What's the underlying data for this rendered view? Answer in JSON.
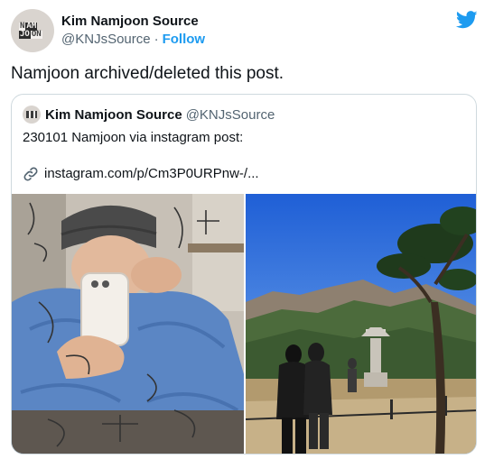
{
  "tweet": {
    "display_name": "Kim Namjoon Source",
    "handle": "@KNJsSource",
    "separator": "·",
    "follow_label": "Follow",
    "avatar_text": [
      "N",
      "AM",
      "JO",
      "ON"
    ],
    "text": "Namjoon archived/deleted this post."
  },
  "quote": {
    "display_name": "Kim Namjoon Source",
    "handle": "@KNJsSource",
    "text": "230101 Namjoon via instagram post:",
    "link": "instagram.com/p/Cm3P0URPnw-/..."
  },
  "icons": {
    "brand": "twitter-bird-icon",
    "link": "link-icon"
  },
  "colors": {
    "accent": "#1d9bf0",
    "text": "#0f1419",
    "muted": "#536471",
    "border": "#cfd9de"
  }
}
